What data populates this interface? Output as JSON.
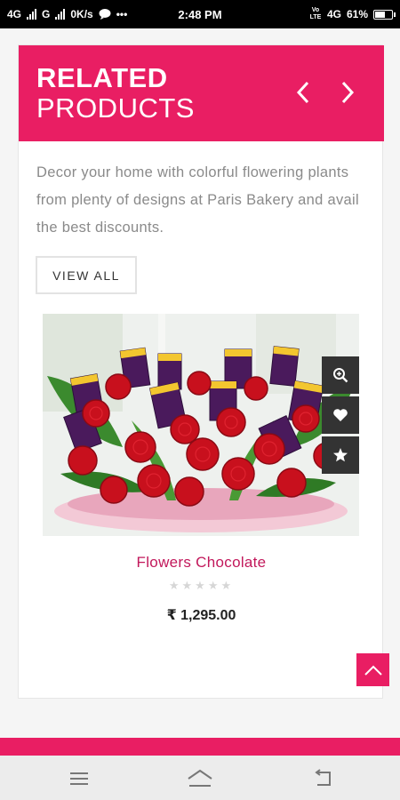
{
  "status_bar": {
    "left_net1": "4G",
    "left_net2": "G",
    "speed": "0K/s",
    "more": "•••",
    "time": "2:48 PM",
    "volte": "Vo LTE",
    "right_net": "4G",
    "battery": "61%"
  },
  "related": {
    "title_bold": "RELATED",
    "title_light": "PRODUCTS",
    "prev_icon": "chevron-left-icon",
    "next_icon": "chevron-right-icon",
    "accent": "#e91e63",
    "description": "Decor your home with colorful flowering plants from plenty of designs at Paris Bakery and avail the best discounts.",
    "view_all_label": "VIEW ALL"
  },
  "product": {
    "name": "Flowers Chocolate",
    "rating": "★★★★★",
    "rating_value": 0,
    "price": "₹ 1,295.00",
    "name_color": "#c2185b",
    "actions": [
      "zoom-icon",
      "heart-icon",
      "star-icon"
    ]
  },
  "scroll_top_icon": "chevron-up-icon",
  "nav_bar": {
    "buttons": [
      "menu-icon",
      "home-icon",
      "back-icon"
    ]
  }
}
